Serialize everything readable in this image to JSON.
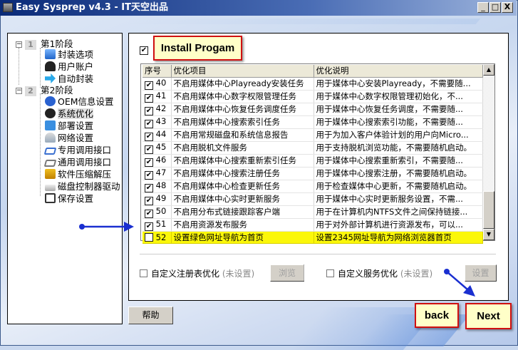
{
  "window": {
    "title": "Easy Sysprep v4.3 - IT天空出品",
    "minimize": "_",
    "maximize": "□",
    "close": "X"
  },
  "tree": {
    "stage1": {
      "num": "1",
      "label": "第1阶段",
      "items": [
        "封装选项",
        "用户账户",
        "自动封装"
      ]
    },
    "stage2": {
      "num": "2",
      "label": "第2阶段",
      "items": [
        "OEM信息设置",
        "系统优化",
        "部署设置",
        "网络设置",
        "专用调用接口",
        "通用调用接口",
        "软件压缩解压",
        "磁盘控制器驱动",
        "保存设置"
      ]
    },
    "selected": "系统优化"
  },
  "callouts": {
    "install": "Install Progam",
    "back": "back",
    "next": "Next"
  },
  "table": {
    "headers": [
      "序号",
      "优化项目",
      "优化说明"
    ],
    "rows": [
      {
        "checked": true,
        "no": "40",
        "item": "不启用媒体中心Playready安装任务",
        "desc": "用于媒体中心安装Playready，不需要随..."
      },
      {
        "checked": true,
        "no": "41",
        "item": "不启用媒体中心数字权限管理任务",
        "desc": "用于媒体中心数字权限管理初始化，不..."
      },
      {
        "checked": true,
        "no": "42",
        "item": "不启用媒体中心恢复任务调度任务",
        "desc": "用于媒体中心恢复任务调度，不需要随..."
      },
      {
        "checked": true,
        "no": "43",
        "item": "不启用媒体中心搜索索引任务",
        "desc": "用于媒体中心搜索索引功能，不需要随..."
      },
      {
        "checked": true,
        "no": "44",
        "item": "不启用常规磁盘和系统信息报告",
        "desc": "用于为加入客户体验计划的用户向Micro..."
      },
      {
        "checked": true,
        "no": "45",
        "item": "不启用脱机文件服务",
        "desc": "用于支持脱机浏览功能，不需要随机启动。"
      },
      {
        "checked": true,
        "no": "46",
        "item": "不启用媒体中心搜索重新索引任务",
        "desc": "用于媒体中心搜索重新索引，不需要随..."
      },
      {
        "checked": true,
        "no": "47",
        "item": "不启用媒体中心搜索注册任务",
        "desc": "用于媒体中心搜索注册，不需要随机启动。"
      },
      {
        "checked": true,
        "no": "48",
        "item": "不启用媒体中心检查更新任务",
        "desc": "用于检查媒体中心更新，不需要随机启动。"
      },
      {
        "checked": true,
        "no": "49",
        "item": "不启用媒体中心实时更新服务",
        "desc": "用于媒体中心实时更新服务设置，不需..."
      },
      {
        "checked": true,
        "no": "50",
        "item": "不启用分布式链接跟踪客户端",
        "desc": "用于在计算机内NTFS文件之间保持链接..."
      },
      {
        "checked": true,
        "no": "51",
        "item": "不启用资源发布服务",
        "desc": "用于对外部计算机进行资源发布，可以..."
      },
      {
        "checked": false,
        "no": "52",
        "item": "设置绿色网址导航为首页",
        "desc": "设置2345网址导航为网络浏览器首页",
        "highlight": true
      }
    ]
  },
  "bottom": {
    "registry_label": "自定义注册表优化",
    "registry_status": "(未设置)",
    "browse": "浏览",
    "service_label": "自定义服务优化",
    "service_status": "(未设置)",
    "settings": "设置"
  },
  "help": "帮助",
  "colors": {
    "highlight": "#fbf70a",
    "callout_border": "#d01010",
    "arrow": "#1a2fd0"
  }
}
